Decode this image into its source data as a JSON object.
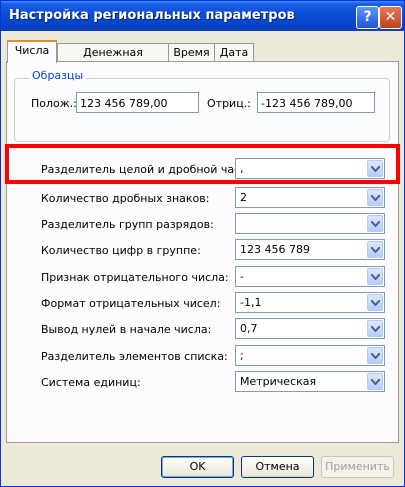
{
  "window": {
    "title": "Настройка региональных параметров",
    "help_glyph": "?",
    "close_glyph": "✕"
  },
  "tabs": [
    {
      "label": "Числа",
      "active": true
    },
    {
      "label": "Денежная единица",
      "active": false
    },
    {
      "label": "Время",
      "active": false
    },
    {
      "label": "Дата",
      "active": false
    }
  ],
  "samples": {
    "group_title": "Образцы",
    "positive_label": "Полож.:",
    "positive_value": "123 456 789,00",
    "negative_label": "Отриц.:",
    "negative_value": "-123 456 789,00"
  },
  "settings": [
    {
      "label": "Разделитель целой и дробной части:",
      "value": ","
    },
    {
      "label": "Количество дробных знаков:",
      "value": "2"
    },
    {
      "label": "Разделитель групп разрядов:",
      "value": ""
    },
    {
      "label": "Количество цифр в группе:",
      "value": "123 456 789"
    },
    {
      "label": "Признак отрицательного числа:",
      "value": "-"
    },
    {
      "label": "Формат отрицательных чисел:",
      "value": "-1,1"
    },
    {
      "label": "Вывод нулей в начале числа:",
      "value": "0,7"
    },
    {
      "label": "Разделитель элементов списка:",
      "value": ";"
    },
    {
      "label": "Система единиц:",
      "value": "Метрическая"
    }
  ],
  "buttons": {
    "ok": "OK",
    "cancel": "Отмена",
    "apply": "Применить"
  },
  "colors": {
    "highlight": "#ff0000",
    "titlebar": "#0a4ed6"
  }
}
